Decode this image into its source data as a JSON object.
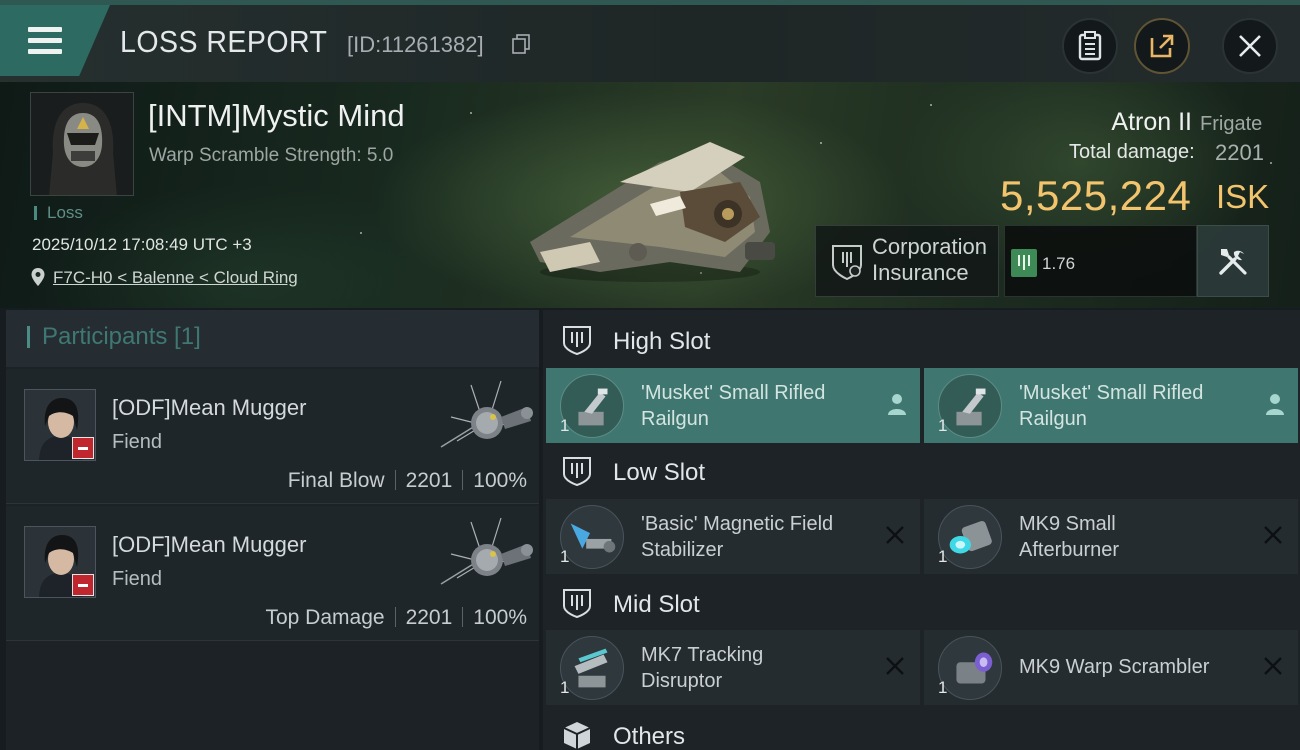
{
  "header": {
    "title": "LOSS REPORT",
    "report_id": "[ID:11261382]"
  },
  "victim": {
    "pilot": "[INTM]Mystic Mind",
    "warp_scramble": "Warp Scramble Strength: 5.0",
    "tag": "Loss",
    "timestamp": "2025/10/12 17:08:49 UTC +3",
    "location": "F7C-H0 < Balenne < Cloud Ring"
  },
  "ship": {
    "name": "Atron II",
    "class": "Frigate",
    "damage_label": "Total damage:",
    "damage_value": "2201",
    "isk_value": "5,525,224",
    "isk_unit": "ISK",
    "insurance_line1": "Corporation",
    "insurance_line2": "Insurance",
    "security": "1.76"
  },
  "participants": {
    "title": "Participants [1]",
    "items": [
      {
        "name": "[ODF]Mean Mugger",
        "ship": "Fiend",
        "label": "Final Blow",
        "damage": "2201",
        "percent": "100%"
      },
      {
        "name": "[ODF]Mean Mugger",
        "ship": "Fiend",
        "label": "Top Damage",
        "damage": "2201",
        "percent": "100%"
      }
    ]
  },
  "fitting": {
    "high_slot": "High Slot",
    "low_slot": "Low Slot",
    "mid_slot": "Mid Slot",
    "others": "Others",
    "high": [
      {
        "line1": "'Musket' Small Rifled",
        "line2": "Railgun",
        "qty": "1",
        "status": "survived"
      },
      {
        "line1": "'Musket' Small Rifled",
        "line2": "Railgun",
        "qty": "1",
        "status": "survived"
      }
    ],
    "low": [
      {
        "line1": "'Basic' Magnetic Field",
        "line2": "Stabilizer",
        "qty": "1",
        "status": "destroyed"
      },
      {
        "line1": "MK9 Small",
        "line2": "Afterburner",
        "qty": "1",
        "status": "destroyed"
      }
    ],
    "mid": [
      {
        "line1": "MK7 Tracking",
        "line2": "Disruptor",
        "qty": "1",
        "status": "destroyed"
      },
      {
        "line1": "MK9 Warp Scrambler",
        "qty": "1",
        "status": "destroyed"
      }
    ]
  },
  "colors": {
    "accent": "#3f7770",
    "isk": "#f2c46d",
    "loss_badge": "#c0262d"
  }
}
